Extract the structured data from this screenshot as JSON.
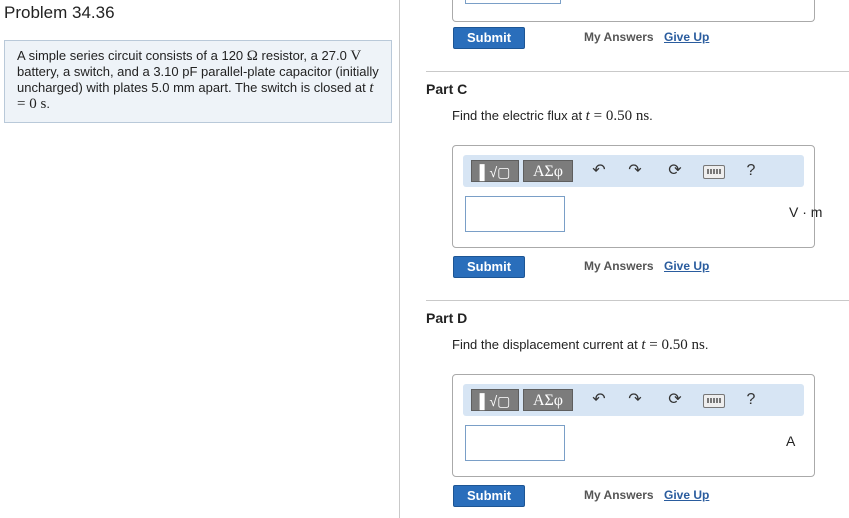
{
  "problem": {
    "title": "Problem 34.36",
    "text_1": "A simple series circuit consists of a 120 ",
    "ohm_symbol": "Ω",
    "text_2": " resistor, a 27.0 ",
    "volt_symbol": "V",
    "text_3": " battery, a switch, and a 3.10 pF parallel-plate capacitor (initially uncharged) with plates 5.0 mm apart. The switch is closed at ",
    "t_var": "t",
    "equals": " = ",
    "t_value": "0 s",
    "text_end": "."
  },
  "actions": {
    "submit_label": "Submit",
    "my_answers_label": "My Answers",
    "give_up_label": "Give Up"
  },
  "toolbar": {
    "templates_label": "▌√▢",
    "symbols_label": "ΑΣφ",
    "help_label": "?"
  },
  "parts": [
    {
      "title": "Part C",
      "question_prefix": "Find the electric flux at ",
      "t_var": "t",
      "equals": " = ",
      "value": "0.50 ns",
      "suffix": ".",
      "input_value": "",
      "unit": "V · m"
    },
    {
      "title": "Part D",
      "question_prefix": "Find the displacement current at ",
      "t_var": "t",
      "equals": " = ",
      "value": "0.50 ns",
      "suffix": ".",
      "input_value": "",
      "unit": "A"
    }
  ]
}
